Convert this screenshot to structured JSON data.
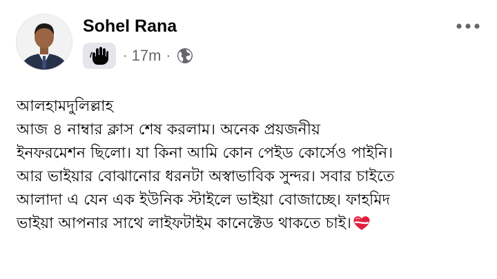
{
  "post": {
    "author_name": "Sohel Rana",
    "timestamp": "17m",
    "separator": "·",
    "audience_icon": "globe-icon",
    "badge_icon": "waving-hand-icon",
    "more_icon": "more-horizontal-icon",
    "text_lines": [
      "আলহামদুলিল্লাহ",
      "আজ ৪ নাম্বার ক্লাস শেষ করলাম। অনেক প্রয়জনীয়",
      "ইনফরমেশন ছিলো। যা কিনা আমি কোন পেইড কোর্সেও পাইনি।",
      "আর ভাইয়ার বোঝানোর ধরনটা অস্বাভাবিক সুন্দর। সবার চাইতে",
      "আলাদা এ যেন এক ইউনিক স্টাইলে ভাইয়া বোজাচ্ছে। ফাহমিদ",
      "ভাইয়া আপনার সাথে লাইফটাইম কানেক্টেড থাকতে চাই।"
    ],
    "trailing_emoji_icon": "heart-ribbon-icon"
  },
  "colors": {
    "text_primary": "#050505",
    "text_secondary": "#65676b",
    "badge_bg": "#e4e6eb",
    "heart": "#e41e3f"
  }
}
